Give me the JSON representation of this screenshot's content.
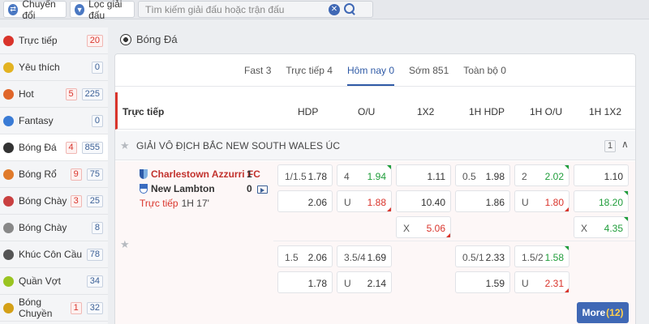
{
  "topbar": {
    "switch_label": "Chuyển đổi",
    "filter_label": "Lọc giải đấu",
    "search_placeholder": "Tìm kiếm giải đấu hoặc trận đấu"
  },
  "sidebar": {
    "items": [
      {
        "label": "Trực tiếp",
        "count": "20",
        "live": "",
        "icon": "live-icon",
        "color": "#d9342b"
      },
      {
        "label": "Yêu thích",
        "count": "0",
        "live": "",
        "icon": "star-icon",
        "color": "#e3b321"
      },
      {
        "label": "Hot",
        "count": "225",
        "live": "5",
        "icon": "fire-icon",
        "color": "#e0662a"
      },
      {
        "label": "Fantasy",
        "count": "0",
        "live": "",
        "icon": "fantasy-icon",
        "color": "#3a7bd5"
      },
      {
        "label": "Bóng Đá",
        "count": "855",
        "live": "4",
        "icon": "soccer-icon",
        "color": "#333333"
      },
      {
        "label": "Bóng Rổ",
        "count": "75",
        "live": "9",
        "icon": "basketball-icon",
        "color": "#e07a2a"
      },
      {
        "label": "Bóng Chày",
        "count": "25",
        "live": "3",
        "icon": "baseball-icon",
        "color": "#c94040"
      },
      {
        "label": "Bóng Chày",
        "count": "8",
        "live": "",
        "icon": "softball-icon",
        "color": "#888888"
      },
      {
        "label": "Khúc Côn Cầu",
        "count": "78",
        "live": "",
        "icon": "hockey-icon",
        "color": "#555555"
      },
      {
        "label": "Quần Vợt",
        "count": "34",
        "live": "",
        "icon": "tennis-icon",
        "color": "#9ac421"
      },
      {
        "label": "Bóng Chuyền",
        "count": "32",
        "live": "1",
        "icon": "volleyball-icon",
        "color": "#d4a017"
      }
    ]
  },
  "main": {
    "sport_title": "Bóng Đá",
    "tabs": [
      "Fast 3",
      "Trực tiếp 4",
      "Hôm nay 0",
      "Sớm 851",
      "Toàn bộ 0"
    ],
    "active_tab": 2,
    "columns": [
      "Trực tiếp",
      "HDP",
      "O/U",
      "1X2",
      "1H HDP",
      "1H O/U",
      "1H 1X2"
    ],
    "league": {
      "name": "GIẢI VÔ ĐỊCH BẮC NEW SOUTH WALES ÚC",
      "count": "1"
    },
    "match": {
      "home": "Charlestown Azzurri FC",
      "away": "New Lambton",
      "home_score": "1",
      "away_score": "0",
      "status": "Trực tiếp",
      "time": "1H 17'",
      "odds": [
        {
          "label": "1/1.5",
          "value": "1.78",
          "tone": "",
          "arrow": ""
        },
        {
          "label": "4",
          "value": "1.94",
          "tone": "green",
          "arrow": "up"
        },
        {
          "label": "",
          "value": "1.11",
          "tone": "",
          "arrow": ""
        },
        {
          "label": "0.5",
          "value": "1.98",
          "tone": "",
          "arrow": ""
        },
        {
          "label": "2",
          "value": "2.02",
          "tone": "green",
          "arrow": "up"
        },
        {
          "label": "",
          "value": "1.10",
          "tone": "",
          "arrow": ""
        },
        {
          "label": "",
          "value": "2.06",
          "tone": "",
          "arrow": ""
        },
        {
          "label": "U",
          "value": "1.88",
          "tone": "red",
          "arrow": "down"
        },
        {
          "label": "",
          "value": "10.40",
          "tone": "",
          "arrow": ""
        },
        {
          "label": "",
          "value": "1.86",
          "tone": "",
          "arrow": ""
        },
        {
          "label": "U",
          "value": "1.80",
          "tone": "red",
          "arrow": "down"
        },
        {
          "label": "",
          "value": "18.20",
          "tone": "green",
          "arrow": "up"
        },
        {
          "label": "X",
          "value": "5.06",
          "tone": "red",
          "arrow": "down"
        },
        {
          "label": "X",
          "value": "4.35",
          "tone": "green",
          "arrow": "up"
        },
        {
          "label": "1.5",
          "value": "2.06",
          "tone": "",
          "arrow": ""
        },
        {
          "label": "3.5/4",
          "value": "1.69",
          "tone": "",
          "arrow": ""
        },
        {
          "label": "0.5/1",
          "value": "2.33",
          "tone": "",
          "arrow": ""
        },
        {
          "label": "1.5/2",
          "value": "1.58",
          "tone": "green",
          "arrow": "up"
        },
        {
          "label": "",
          "value": "1.78",
          "tone": "",
          "arrow": ""
        },
        {
          "label": "U",
          "value": "2.14",
          "tone": "",
          "arrow": ""
        },
        {
          "label": "",
          "value": "1.59",
          "tone": "",
          "arrow": ""
        },
        {
          "label": "U",
          "value": "2.31",
          "tone": "red",
          "arrow": "down"
        }
      ]
    },
    "more": {
      "label": "More",
      "count": "(12)"
    }
  }
}
